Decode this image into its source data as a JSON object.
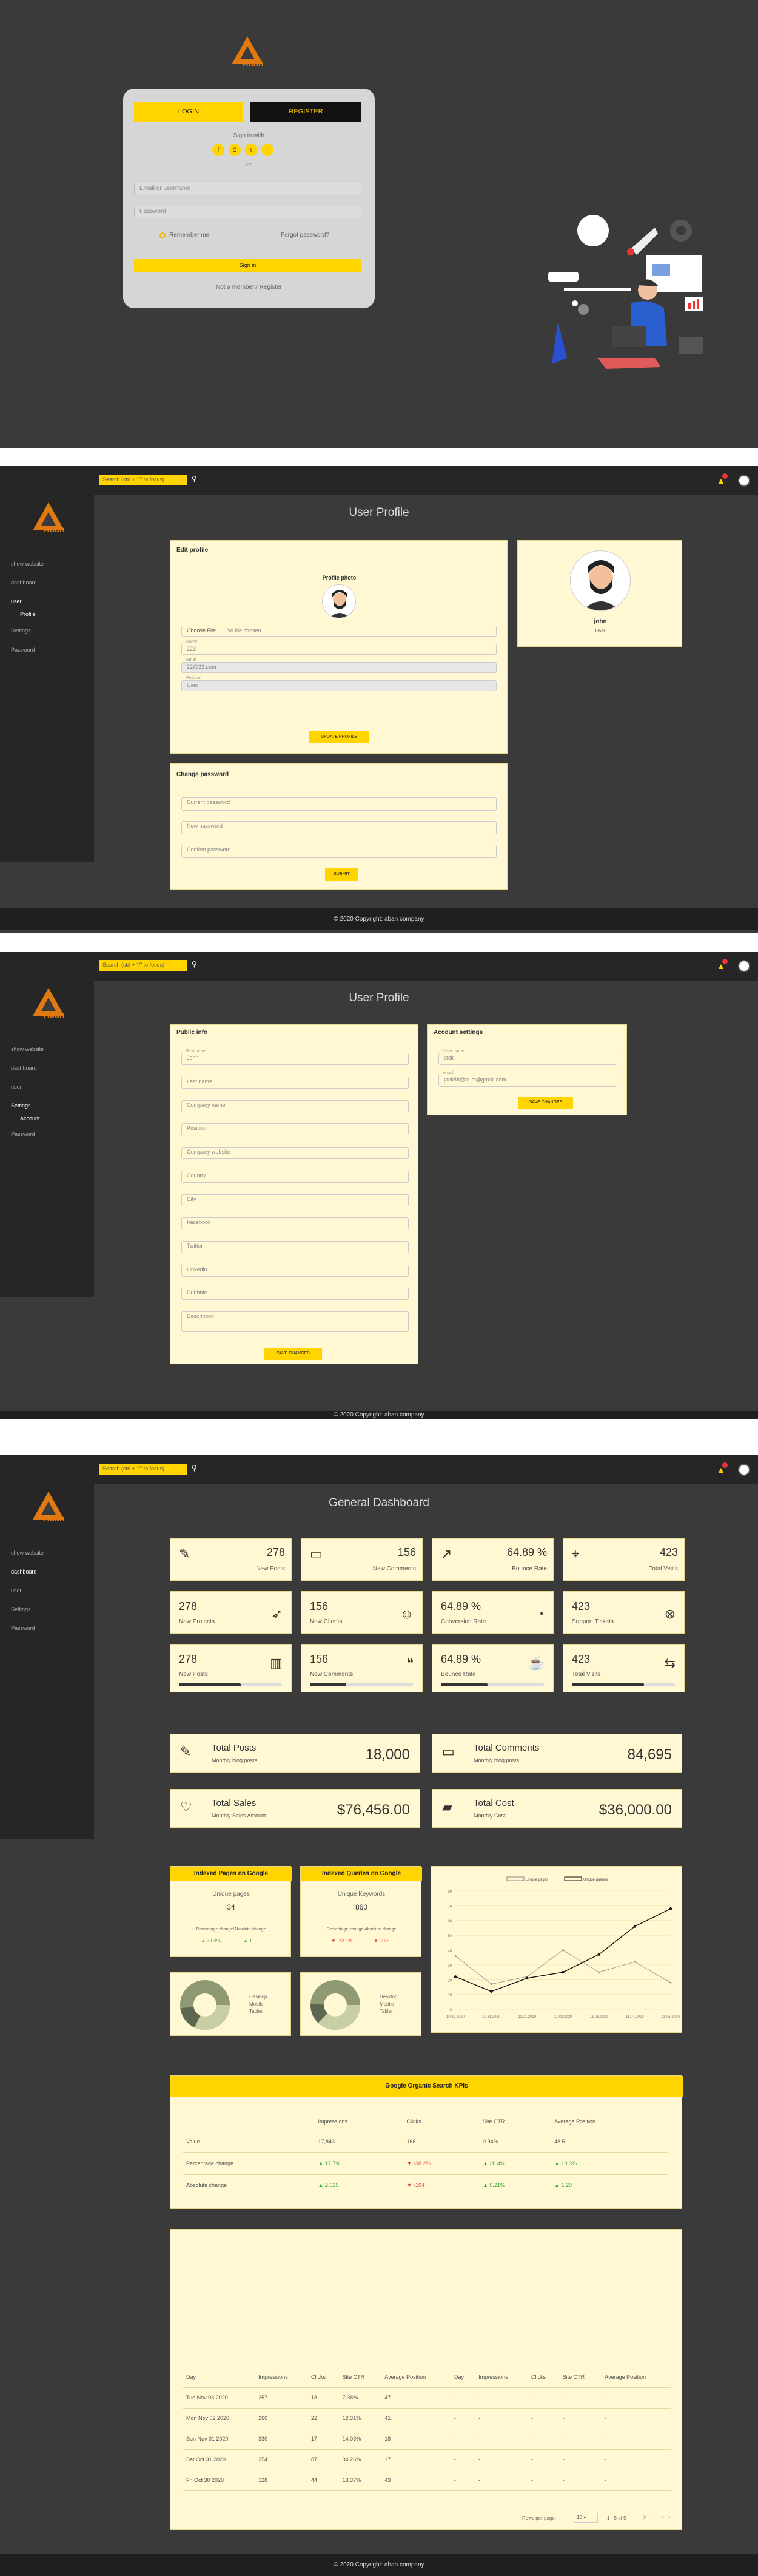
{
  "brand": {
    "name": "Aban"
  },
  "login": {
    "tab_login": "LOGIN",
    "tab_register": "REGISTER",
    "signin_with": "Sign in with",
    "social": [
      "f",
      "G",
      "t",
      "in"
    ],
    "or": "or",
    "email_placeholder": "Email or username",
    "password_placeholder": "Password",
    "remember": "Remember me",
    "forgot": "Forgot password?",
    "submit": "Sign in",
    "not_member": "Not a member?",
    "register_link": "Register"
  },
  "topbar": {
    "search_placeholder": "Search (ctrl + \"/\" to focus)",
    "badge_count": "1"
  },
  "sidebar": {
    "items": [
      "show website",
      "dashboard",
      "user",
      "Settings",
      "Password"
    ],
    "sub_profile": "Profile",
    "sub_account": "Account"
  },
  "profile": {
    "title": "User Profile",
    "edit_title": "Edit profile",
    "photo_label": "Profile photo",
    "choose_file": "Choose File",
    "no_file": "No file chosen",
    "name_label": "Name",
    "name_value": "223",
    "email_label": "Email",
    "email_value": "22@22.com",
    "role_label": "Position",
    "role_value": "User",
    "update_btn": "UPDATE PROFILE",
    "change_pw_title": "Change password",
    "current_pw": "Current password",
    "new_pw": "New password",
    "confirm_pw": "Confirm password",
    "submit_btn": "SUBMIT",
    "card_name": "john",
    "card_role": "User"
  },
  "settings": {
    "title": "User Profile",
    "public_title": "Public info",
    "first_name_label": "First name",
    "first_name": "John",
    "fields": [
      "Last name",
      "Company name",
      "Position",
      "Company website",
      "Country",
      "City",
      "Facebook",
      "Twitter",
      "Linkedin",
      "Dribbble",
      "Description"
    ],
    "save_btn": "SAVE CHANGES",
    "account_title": "Account settings",
    "username_label": "User name",
    "username": "jack",
    "email_label": "email",
    "email": "jack88@trust@gmail.com",
    "save_btn2": "SAVE CHANGES"
  },
  "footer": {
    "text": "© 2020 Copyright: aban company"
  },
  "dashboard": {
    "title": "General Dashboard",
    "tiles": [
      {
        "num": "278",
        "label": "New Posts",
        "icon": "✎"
      },
      {
        "num": "156",
        "label": "New Comments",
        "icon": "▭"
      },
      {
        "num": "64.89 %",
        "label": "Bounce Rate",
        "icon": "↗"
      },
      {
        "num": "423",
        "label": "Total Visits",
        "icon": "⌖"
      },
      {
        "num": "278",
        "label": "New Projects",
        "icon": "➶"
      },
      {
        "num": "156",
        "label": "New Clients",
        "icon": "☺"
      },
      {
        "num": "64.89 %",
        "label": "Conversion Rate",
        "icon": "◔"
      },
      {
        "num": "423",
        "label": "Support Tickets",
        "icon": "⊗"
      },
      {
        "num": "278",
        "label": "New Posts",
        "icon": "▥"
      },
      {
        "num": "156",
        "label": "New Comments",
        "icon": "❝"
      },
      {
        "num": "64.89 %",
        "label": "Bounce Rate",
        "icon": "☕"
      },
      {
        "num": "423",
        "label": "Total Visits",
        "icon": "⇆"
      }
    ],
    "progress": [
      0.6,
      0.35,
      0.45,
      0.7
    ],
    "wide": [
      {
        "title": "Total Posts",
        "sub": "Monthly blog posts",
        "value": "18,000",
        "icon": "✎"
      },
      {
        "title": "Total Comments",
        "sub": "Monthly blog posts",
        "value": "84,695",
        "icon": "▭"
      },
      {
        "title": "Total Sales",
        "sub": "Monthly Sales Amount",
        "value": "$76,456.00",
        "icon": "♡"
      },
      {
        "title": "Total Cost",
        "sub": "Monthly Cost",
        "value": "$36,000.00",
        "icon": "▰"
      }
    ],
    "indexed_pages": {
      "title": "Indexed Pages on Google",
      "label": "Unique pages",
      "value": "34",
      "change_hdr": "Percentage change/Absolute change",
      "pct": "▲ 3.03%",
      "abs": "▲ 1"
    },
    "indexed_queries": {
      "title": "Indexed Queries on Google",
      "label": "Unique Keywords",
      "value": "860",
      "change_hdr": "Percentage change/Absolute change",
      "pct": "▼ -12.1%",
      "abs": "▼ -105"
    },
    "donut_legend": [
      "Desktop",
      "Mobile",
      "Tablet"
    ],
    "gsc": {
      "title": "Google Organic Search KPIs",
      "headers": [
        "",
        "Impressions",
        "Clicks",
        "Site CTR",
        "Average Position"
      ],
      "rows": [
        [
          "Value",
          "17,843",
          "168",
          "0.94%",
          "48.5"
        ],
        [
          "Percentage change",
          "▲ 17.7%",
          "▼ -38.2%",
          "▲ 28.4%",
          "▲ 10.3%"
        ],
        [
          "Absolute change",
          "▲ 2,625",
          "▼ -104",
          "▲ 0.21%",
          "▲ 1.20"
        ]
      ]
    },
    "table": {
      "headers": [
        "Day",
        "Impressions",
        "Clicks",
        "Site CTR",
        "Average Position",
        "Day",
        "Impressions",
        "Clicks",
        "Site CTR",
        "Average Position"
      ],
      "rows": [
        [
          "Tue Nov 03 2020",
          "257",
          "18",
          "7.38%",
          "47",
          "-",
          "-",
          "-",
          "-",
          "-"
        ],
        [
          "Mon Nov 02 2020",
          "260",
          "22",
          "12.31%",
          "41",
          "-",
          "-",
          "-",
          "-",
          "-"
        ],
        [
          "Sun Nov 01 2020",
          "330",
          "17",
          "14.03%",
          "18",
          "-",
          "-",
          "-",
          "-",
          "-"
        ],
        [
          "Sat Oct 31 2020",
          "254",
          "87",
          "34.26%",
          "17",
          "-",
          "-",
          "-",
          "-",
          "-"
        ],
        [
          "Fri Oct 30 2020",
          "128",
          "44",
          "13.37%",
          "43",
          "-",
          "-",
          "-",
          "-",
          "-"
        ]
      ],
      "rows_per_page": "Rows per page:",
      "rpp_value": "10",
      "range": "1 - 5 of 5"
    }
  },
  "chart_data": {
    "type": "line",
    "x": [
      "10.30.2020",
      "10.31.2020",
      "11.01.2020",
      "11.02.2020",
      "11.03.2020",
      "11.04.2020",
      "11.05.2020"
    ],
    "series": [
      {
        "name": "Unique pages",
        "values": [
          36,
          17,
          22,
          40,
          25,
          32,
          18
        ]
      },
      {
        "name": "Unique queries",
        "values": [
          22,
          12,
          21,
          25,
          37,
          56,
          68
        ]
      }
    ],
    "ylim": [
      0,
      80
    ],
    "y_ticks": [
      "80",
      "70",
      "60",
      "50",
      "40",
      "30",
      "20",
      "10",
      "0"
    ],
    "legend": "top"
  }
}
